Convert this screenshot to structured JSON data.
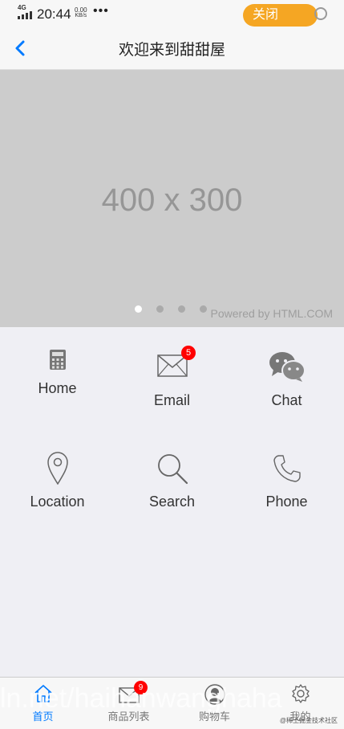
{
  "status_bar": {
    "network": "4G",
    "time": "20:44",
    "speed_value": "0.00",
    "speed_unit": "KB/s",
    "more": "•••"
  },
  "close_button": "关闭",
  "nav": {
    "title": "欢迎来到甜甜屋"
  },
  "banner": {
    "placeholder_text": "400 x 300",
    "powered_by": "Powered by HTML.COM",
    "slide_count": 4,
    "active_slide": 1
  },
  "grid": [
    {
      "label": "Home",
      "icon": "calculator-icon"
    },
    {
      "label": "Email",
      "icon": "envelope-icon",
      "badge": "5"
    },
    {
      "label": "Chat",
      "icon": "chat-bubbles-icon"
    },
    {
      "label": "Location",
      "icon": "map-pin-icon"
    },
    {
      "label": "Search",
      "icon": "magnifier-icon"
    },
    {
      "label": "Phone",
      "icon": "phone-icon"
    }
  ],
  "tabbar": [
    {
      "label": "首页",
      "icon": "home-icon",
      "active": true
    },
    {
      "label": "商品列表",
      "icon": "envelope-icon",
      "badge": "9"
    },
    {
      "label": "购物车",
      "icon": "user-icon"
    },
    {
      "label": "我的",
      "icon": "gear-icon"
    }
  ],
  "watermark": "ln.net/haihanwanghaha",
  "watermark_small": "@稀土掘金技术社区",
  "colors": {
    "accent": "#007aff",
    "close_pill": "#f5a623",
    "badge": "#ff0000",
    "banner_bg": "#cccccc"
  }
}
